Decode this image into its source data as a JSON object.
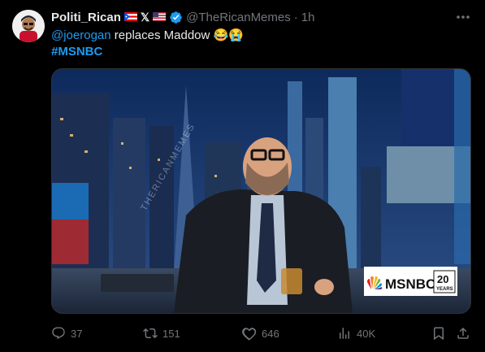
{
  "user": {
    "display_name": "Politi_Rican",
    "handle": "@TheRicanMemes",
    "separator": "·",
    "time": "1h",
    "badges": [
      "puerto-rico-flag",
      "x-mark",
      "usa-flag",
      "verified-badge"
    ],
    "x_badge_text": "𝕏"
  },
  "tweet": {
    "mention": "@joerogan",
    "body": " replaces Maddow ",
    "emojis": "😂😭",
    "hashtag": "#MSNBC"
  },
  "media": {
    "description_only": false,
    "logo_text": "MSNBC",
    "logo_badge": "20",
    "logo_badge_sub": "YEARS",
    "watermark": "THERICANMEMES"
  },
  "actions": {
    "replies": "37",
    "reposts": "151",
    "likes": "646",
    "views": "40K"
  },
  "colors": {
    "accent": "#1d9bf0",
    "muted": "#71767b",
    "background": "#000000"
  }
}
